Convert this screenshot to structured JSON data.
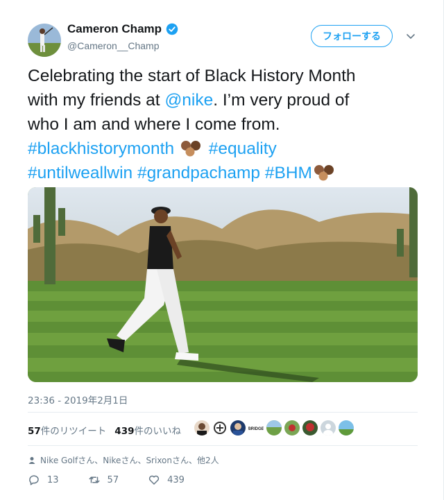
{
  "user": {
    "name": "Cameron Champ",
    "handle": "@Cameron__Champ",
    "verified": true
  },
  "follow_button": "フォローする",
  "tweet": {
    "line1": "Celebrating the start of Black History Month",
    "line2_prefix": "with my friends at ",
    "mention": "@nike",
    "line2_suffix": ". I’m very proud of",
    "line3": "who I am and where I come from.",
    "hashtag1": "#blackhistorymonth",
    "hashtag2": "#equality",
    "hashtag3": "#untilweallwin",
    "hashtag4": "#grandpachamp",
    "hashtag5": "#BHM"
  },
  "timestamp": "23:36 - 2019年2月1日",
  "stats": {
    "retweets": "57",
    "retweets_label": "件のリツイート",
    "likes": "439",
    "likes_label": "件のいいね"
  },
  "context": "Nike Golfさん、Nikeさん、Srixonさん、他2人",
  "actions": {
    "replies": "13",
    "retweets": "57",
    "likes": "439"
  },
  "colors": {
    "accent": "#1da1f2",
    "text": "#14171a",
    "muted": "#657786"
  }
}
